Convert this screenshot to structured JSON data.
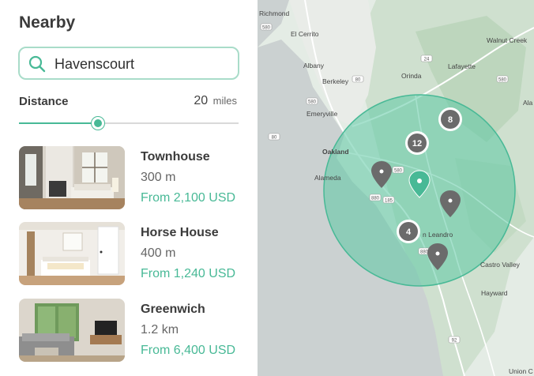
{
  "panel": {
    "title": "Nearby",
    "search": {
      "value": "Havenscourt",
      "icon": "search-icon"
    },
    "distance": {
      "label": "Distance",
      "value": "20",
      "unit": "miles",
      "level_fraction": 0.36
    },
    "listings": [
      {
        "name": "Townhouse",
        "distance": "300 m",
        "price": "From 2,100 USD"
      },
      {
        "name": "Horse House",
        "distance": "400 m",
        "price": "From 1,240 USD"
      },
      {
        "name": "Greenwich",
        "distance": "1.2 km",
        "price": "From 6,400 USD"
      }
    ]
  },
  "map": {
    "places": [
      "Richmond",
      "El Cerrito",
      "Albany",
      "Berkeley",
      "Emeryville",
      "Orinda",
      "Lafayette",
      "Walnut Creek",
      "Ala",
      "Oakland",
      "Alameda",
      "n Leandro",
      "Castro Valley",
      "Hayward",
      "Union C"
    ],
    "highway_shields": [
      "580",
      "24",
      "580",
      "80",
      "580",
      "880",
      "185",
      "880",
      "580",
      "92",
      "80"
    ],
    "clusters": [
      "8",
      "12",
      "4"
    ],
    "accent_color": "#48b996",
    "pin_color": "#6b6b6b"
  }
}
